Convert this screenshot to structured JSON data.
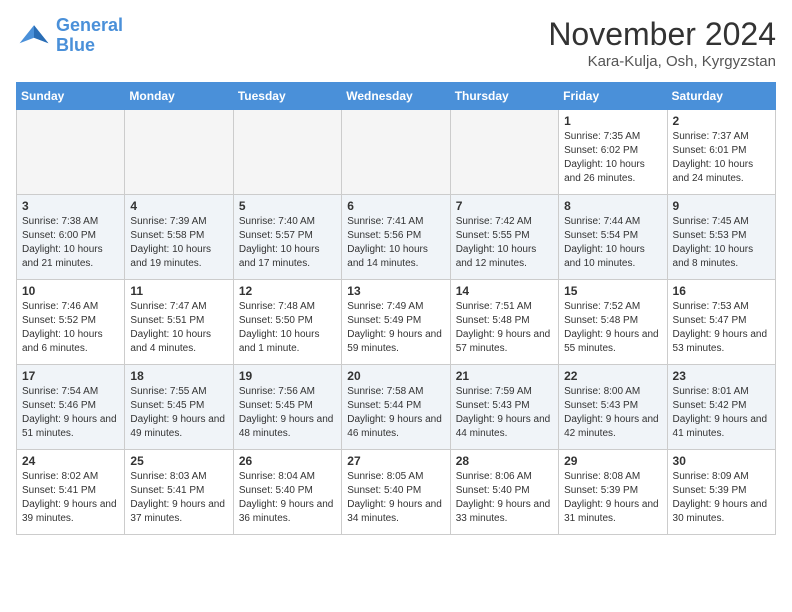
{
  "logo": {
    "line1": "General",
    "line2": "Blue"
  },
  "title": "November 2024",
  "location": "Kara-Kulja, Osh, Kyrgyzstan",
  "days_of_week": [
    "Sunday",
    "Monday",
    "Tuesday",
    "Wednesday",
    "Thursday",
    "Friday",
    "Saturday"
  ],
  "weeks": [
    [
      {
        "num": "",
        "info": ""
      },
      {
        "num": "",
        "info": ""
      },
      {
        "num": "",
        "info": ""
      },
      {
        "num": "",
        "info": ""
      },
      {
        "num": "",
        "info": ""
      },
      {
        "num": "1",
        "info": "Sunrise: 7:35 AM\nSunset: 6:02 PM\nDaylight: 10 hours and 26 minutes."
      },
      {
        "num": "2",
        "info": "Sunrise: 7:37 AM\nSunset: 6:01 PM\nDaylight: 10 hours and 24 minutes."
      }
    ],
    [
      {
        "num": "3",
        "info": "Sunrise: 7:38 AM\nSunset: 6:00 PM\nDaylight: 10 hours and 21 minutes."
      },
      {
        "num": "4",
        "info": "Sunrise: 7:39 AM\nSunset: 5:58 PM\nDaylight: 10 hours and 19 minutes."
      },
      {
        "num": "5",
        "info": "Sunrise: 7:40 AM\nSunset: 5:57 PM\nDaylight: 10 hours and 17 minutes."
      },
      {
        "num": "6",
        "info": "Sunrise: 7:41 AM\nSunset: 5:56 PM\nDaylight: 10 hours and 14 minutes."
      },
      {
        "num": "7",
        "info": "Sunrise: 7:42 AM\nSunset: 5:55 PM\nDaylight: 10 hours and 12 minutes."
      },
      {
        "num": "8",
        "info": "Sunrise: 7:44 AM\nSunset: 5:54 PM\nDaylight: 10 hours and 10 minutes."
      },
      {
        "num": "9",
        "info": "Sunrise: 7:45 AM\nSunset: 5:53 PM\nDaylight: 10 hours and 8 minutes."
      }
    ],
    [
      {
        "num": "10",
        "info": "Sunrise: 7:46 AM\nSunset: 5:52 PM\nDaylight: 10 hours and 6 minutes."
      },
      {
        "num": "11",
        "info": "Sunrise: 7:47 AM\nSunset: 5:51 PM\nDaylight: 10 hours and 4 minutes."
      },
      {
        "num": "12",
        "info": "Sunrise: 7:48 AM\nSunset: 5:50 PM\nDaylight: 10 hours and 1 minute."
      },
      {
        "num": "13",
        "info": "Sunrise: 7:49 AM\nSunset: 5:49 PM\nDaylight: 9 hours and 59 minutes."
      },
      {
        "num": "14",
        "info": "Sunrise: 7:51 AM\nSunset: 5:48 PM\nDaylight: 9 hours and 57 minutes."
      },
      {
        "num": "15",
        "info": "Sunrise: 7:52 AM\nSunset: 5:48 PM\nDaylight: 9 hours and 55 minutes."
      },
      {
        "num": "16",
        "info": "Sunrise: 7:53 AM\nSunset: 5:47 PM\nDaylight: 9 hours and 53 minutes."
      }
    ],
    [
      {
        "num": "17",
        "info": "Sunrise: 7:54 AM\nSunset: 5:46 PM\nDaylight: 9 hours and 51 minutes."
      },
      {
        "num": "18",
        "info": "Sunrise: 7:55 AM\nSunset: 5:45 PM\nDaylight: 9 hours and 49 minutes."
      },
      {
        "num": "19",
        "info": "Sunrise: 7:56 AM\nSunset: 5:45 PM\nDaylight: 9 hours and 48 minutes."
      },
      {
        "num": "20",
        "info": "Sunrise: 7:58 AM\nSunset: 5:44 PM\nDaylight: 9 hours and 46 minutes."
      },
      {
        "num": "21",
        "info": "Sunrise: 7:59 AM\nSunset: 5:43 PM\nDaylight: 9 hours and 44 minutes."
      },
      {
        "num": "22",
        "info": "Sunrise: 8:00 AM\nSunset: 5:43 PM\nDaylight: 9 hours and 42 minutes."
      },
      {
        "num": "23",
        "info": "Sunrise: 8:01 AM\nSunset: 5:42 PM\nDaylight: 9 hours and 41 minutes."
      }
    ],
    [
      {
        "num": "24",
        "info": "Sunrise: 8:02 AM\nSunset: 5:41 PM\nDaylight: 9 hours and 39 minutes."
      },
      {
        "num": "25",
        "info": "Sunrise: 8:03 AM\nSunset: 5:41 PM\nDaylight: 9 hours and 37 minutes."
      },
      {
        "num": "26",
        "info": "Sunrise: 8:04 AM\nSunset: 5:40 PM\nDaylight: 9 hours and 36 minutes."
      },
      {
        "num": "27",
        "info": "Sunrise: 8:05 AM\nSunset: 5:40 PM\nDaylight: 9 hours and 34 minutes."
      },
      {
        "num": "28",
        "info": "Sunrise: 8:06 AM\nSunset: 5:40 PM\nDaylight: 9 hours and 33 minutes."
      },
      {
        "num": "29",
        "info": "Sunrise: 8:08 AM\nSunset: 5:39 PM\nDaylight: 9 hours and 31 minutes."
      },
      {
        "num": "30",
        "info": "Sunrise: 8:09 AM\nSunset: 5:39 PM\nDaylight: 9 hours and 30 minutes."
      }
    ]
  ]
}
